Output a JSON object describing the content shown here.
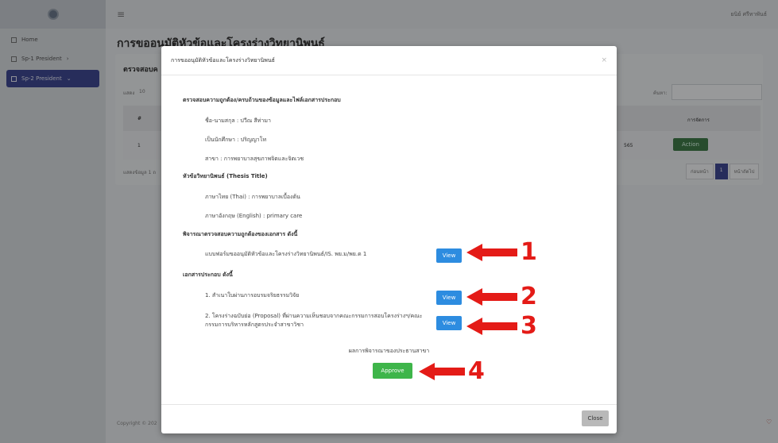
{
  "sidebar": {
    "items": [
      {
        "label": "Home",
        "icon": "grid-icon"
      },
      {
        "label": "Sp-1 President",
        "icon": "page-icon"
      },
      {
        "label": "Sp-2 President",
        "icon": "page-icon"
      }
    ]
  },
  "topbar": {
    "user": "ยนิย์ ศรีทาพันธ์"
  },
  "page": {
    "title": "การขออนุมัติหัวข้อและโครงร่างวิทยานิพนธ์",
    "card_header": "ตรวจสอบค",
    "show_label": "แสดง",
    "show_value": "10",
    "search_label": "ค้นหา:",
    "col_number": "#",
    "col_action": "การจัดการ",
    "row_number": "1",
    "row_year": "565",
    "action_label": "Action",
    "info": "แสดงข้อมูล 1 ถ",
    "pager_prev": "ก่อนหน้า",
    "pager_current": "1",
    "pager_next": "หน้าถัดไป",
    "footer": "Copyright © 202"
  },
  "modal": {
    "title": "การขออนุมัติหัวข้อและโครงร่างวิทยานิพนธ์",
    "section_check": "ตรวจสอบความถูกต้อง/ครบถ้วนของข้อมูลและไฟล์เอกสารประกอบ",
    "name": "ชื่อ-นามสกุล : ปวีณ สีท่ามา",
    "student_type": "เป็นนักศึกษา : ปริญญาโท",
    "major": "สาขา : การพยาบาลสุขภาพจิตและจิตเวช",
    "section_title": "หัวข้อวิทยานิพนธ์ (Thesis Title)",
    "title_th": "ภาษาไทย (Thai) : การพยาบาลเบื้องต้น",
    "title_en": "ภาษาอังกฤษ (English) : primary care",
    "section_docs": "พิจารณาตรวจสอบความถูกต้องของเอกสาร ดังนี้",
    "doc_form": "แบบฟอร์มขออนุมัติหัวข้อและโครงร่างวิทยานิพนธ์/IS. พย.ม/พย.ด 1",
    "section_attach": "เอกสารประกอบ ดังนี้",
    "attach_1": "1. สำเนาใบผ่านการอบรมจริยธรรมวิจัย",
    "attach_2": "2. โครงร่างฉบับย่อ (Proposal) ที่ผ่านความเห็นชอบจากคณะกรรมการสอบโครงร่างฯ/คณะกรรมการบริหารหลักสูตรประจำสาขาวิชา",
    "view_label": "View",
    "result_label": "ผลการพิจารณาของประธานสาขา",
    "approve_label": "Approve",
    "close_label": "Close"
  },
  "annotations": [
    "1",
    "2",
    "3",
    "4"
  ],
  "colors": {
    "view_button": "#2d8ce0",
    "approve_button": "#3eb54a",
    "annotation": "#e41b17",
    "sidebar_active": "#3e4a9c"
  }
}
